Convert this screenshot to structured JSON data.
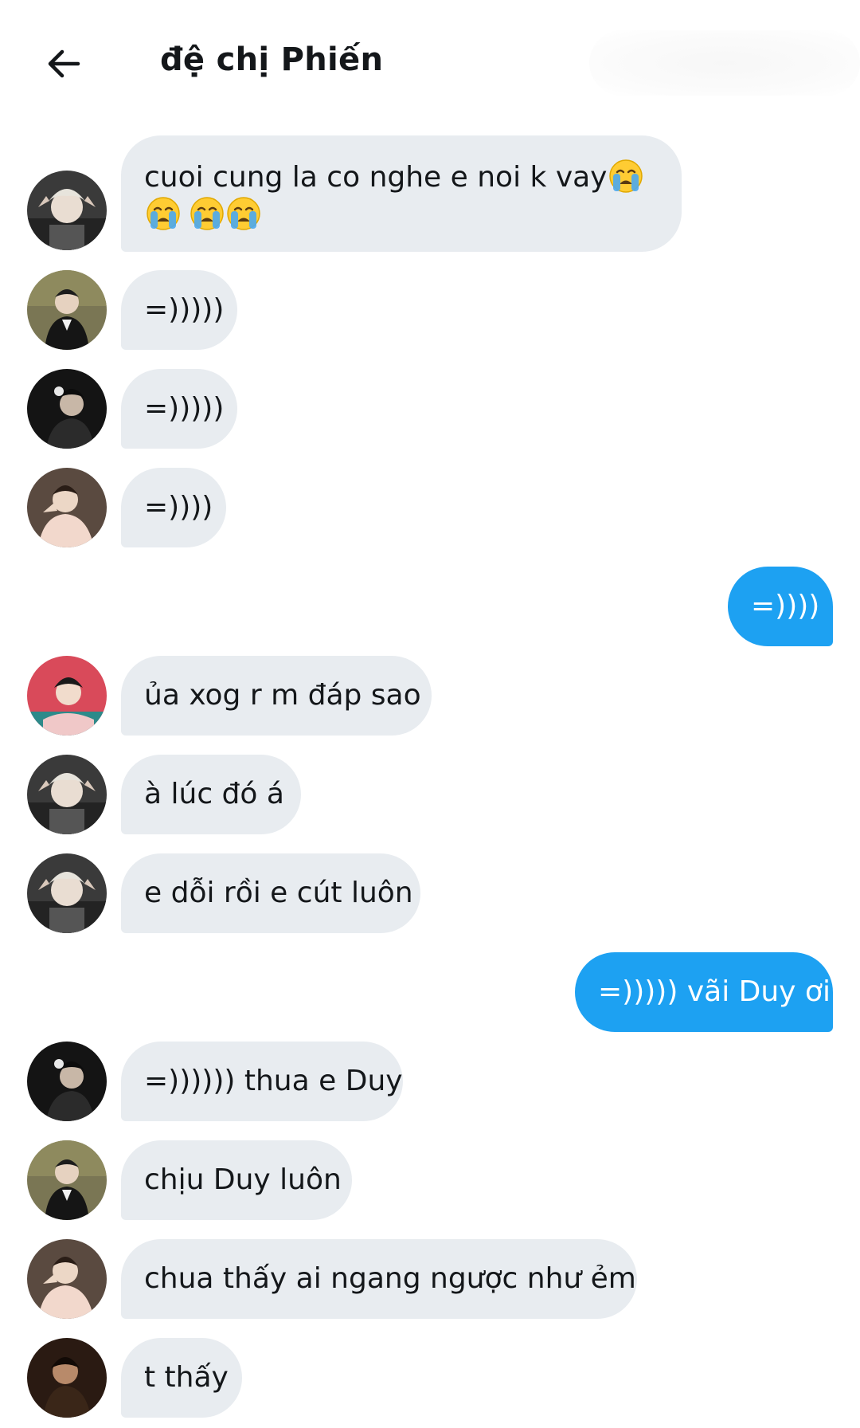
{
  "header": {
    "title": "đệ chị Phiến",
    "back_icon": "arrow-left-icon"
  },
  "messages": [
    {
      "id": 1,
      "side": "in",
      "avatar": "avatar-silver-hair",
      "text": "cuoi cung la co nghe e noi k vay",
      "emoji_tail": "loudly-crying-face x4"
    },
    {
      "id": 2,
      "side": "in",
      "avatar": "avatar-black-jacket",
      "text": "=)))))"
    },
    {
      "id": 3,
      "side": "in",
      "avatar": "avatar-dark-portrait",
      "text": "=)))))"
    },
    {
      "id": 4,
      "side": "in",
      "avatar": "avatar-cream-shirt",
      "text": "=))))"
    },
    {
      "id": 5,
      "side": "out",
      "text": "=))))"
    },
    {
      "id": 6,
      "side": "in",
      "avatar": "avatar-pink-background",
      "text": "ủa xog r m đáp sao"
    },
    {
      "id": 7,
      "side": "in",
      "avatar": "avatar-silver-hair",
      "text": "à lúc đó á"
    },
    {
      "id": 8,
      "side": "in",
      "avatar": "avatar-silver-hair",
      "text": "e dỗi rồi e cút luôn"
    },
    {
      "id": 9,
      "side": "out",
      "text": "=))))) vãi Duy ơi"
    },
    {
      "id": 10,
      "side": "in",
      "avatar": "avatar-dark-portrait",
      "text": "=)))))) thua e Duy"
    },
    {
      "id": 11,
      "side": "in",
      "avatar": "avatar-black-jacket",
      "text": "chịu Duy luôn"
    },
    {
      "id": 12,
      "side": "in",
      "avatar": "avatar-cream-shirt",
      "text": "chua thấy ai ngang ngược như ẻm"
    },
    {
      "id": 13,
      "side": "in",
      "avatar": "avatar-dark-brown",
      "text": "t thấy"
    }
  ],
  "colors": {
    "incoming_bubble": "#e8ecf0",
    "outgoing_bubble": "#1da1f2",
    "outgoing_text": "#ffffff",
    "text": "#14171a"
  }
}
